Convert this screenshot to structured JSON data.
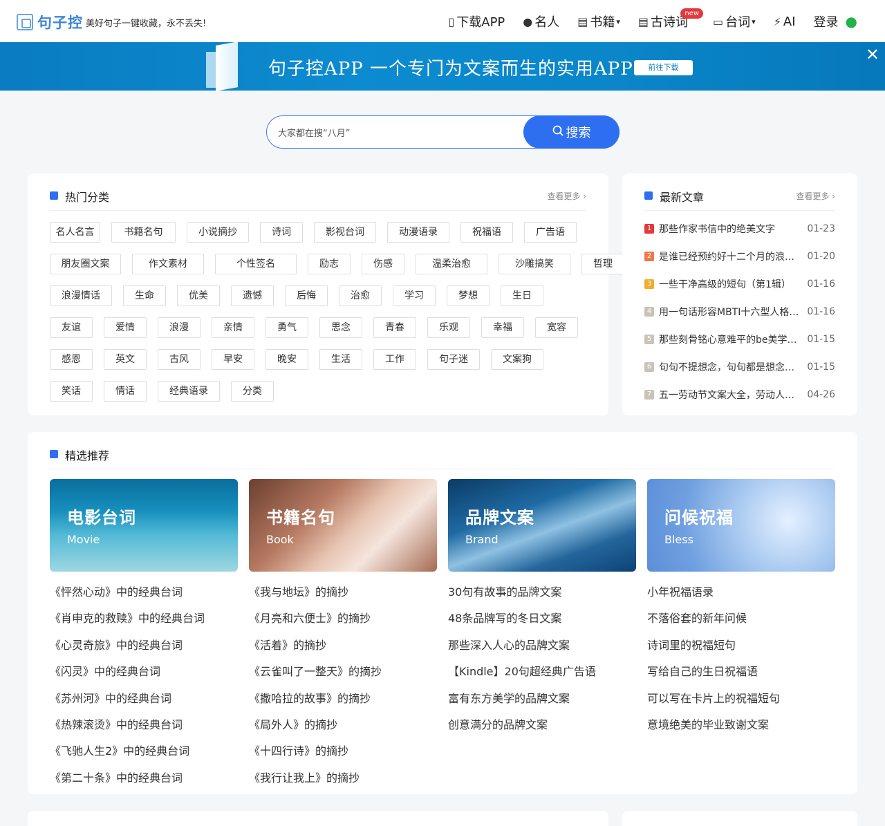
{
  "header": {
    "logo_text": "句子控",
    "slogan": "美好句子一键收藏，永不丢失!",
    "nav": [
      {
        "label": "下载APP",
        "icon": "phone-icon",
        "glyph": "▯"
      },
      {
        "label": "名人",
        "icon": "user-icon",
        "glyph": "👤"
      },
      {
        "label": "书籍",
        "icon": "book-icon",
        "glyph": "▤",
        "caret": "▾"
      },
      {
        "label": "古诗词",
        "icon": "poem-icon",
        "glyph": "▤",
        "badge": "new"
      },
      {
        "label": "台词",
        "icon": "film-icon",
        "glyph": "▭",
        "caret": "▾"
      },
      {
        "label": "AI",
        "icon": "magic-wand-icon",
        "glyph": "⚡"
      }
    ],
    "login": "登录"
  },
  "banner": {
    "title": "句子控APP 一个专门为文案而生的实用APP",
    "button": "前往下载",
    "close": "✕"
  },
  "search": {
    "placeholder": "大家都在搜“八月”",
    "button": "搜索"
  },
  "hot_categories": {
    "title": "热门分类",
    "more": "查看更多 ›",
    "tags": [
      "名人名言",
      "书籍名句",
      "小说摘抄",
      "诗词",
      "影视台词",
      "动漫语录",
      "祝福语",
      "广告语",
      "朋友圈文案",
      "作文素材",
      "个性签名",
      "励志",
      "伤感",
      "温柔治愈",
      "沙雕搞笑",
      "哲理",
      "浪漫情话",
      "生命",
      "优美",
      "遗憾",
      "后悔",
      "治愈",
      "学习",
      "梦想",
      "生日",
      "友谊",
      "爱情",
      "浪漫",
      "亲情",
      "勇气",
      "思念",
      "青春",
      "乐观",
      "幸福",
      "宽容",
      "感恩",
      "英文",
      "古风",
      "早安",
      "晚安",
      "生活",
      "工作",
      "句子迷",
      "文案狗",
      "笑话",
      "情话",
      "经典语录",
      "分类"
    ]
  },
  "latest_articles": {
    "title": "最新文章",
    "more": "查看更多 ›",
    "items": [
      {
        "num": "1",
        "title": "那些作家书信中的绝美文字",
        "date": "01-23",
        "color": "#e4393c"
      },
      {
        "num": "2",
        "title": "是谁已经预约好十二个月的浪漫…",
        "date": "01-20",
        "color": "#f0774a"
      },
      {
        "num": "3",
        "title": "一些干净高级的短句（第1辑）",
        "date": "01-16",
        "color": "#f0ad2e"
      },
      {
        "num": "4",
        "title": "用一句话形容MBTI十六型人格…",
        "date": "01-16",
        "color": "#c8c3b8"
      },
      {
        "num": "5",
        "title": "那些刻骨铭心意难平的be美学…",
        "date": "01-15",
        "color": "#c8c3b8"
      },
      {
        "num": "6",
        "title": "句句不提想念，句句都是想念…",
        "date": "01-15",
        "color": "#c8c3b8"
      },
      {
        "num": "7",
        "title": "五一劳动节文案大全，劳动人民…",
        "date": "04-26",
        "color": "#c8c3b8"
      }
    ]
  },
  "featured": {
    "title": "精选推荐",
    "columns": [
      {
        "name": "电影台词",
        "sub": "Movie",
        "items": [
          "《怦然心动》中的经典台词",
          "《肖申克的救赎》中的经典台词",
          "《心灵奇旅》中的经典台词",
          "《闪灵》中的经典台词",
          "《苏州河》中的经典台词",
          "《热辣滚烫》中的经典台词",
          "《飞驰人生2》中的经典台词",
          "《第二十条》中的经典台词"
        ]
      },
      {
        "name": "书籍名句",
        "sub": "Book",
        "items": [
          "《我与地坛》的摘抄",
          "《月亮和六便士》的摘抄",
          "《活着》的摘抄",
          "《云雀叫了一整天》的摘抄",
          "《撒哈拉的故事》的摘抄",
          "《局外人》的摘抄",
          "《十四行诗》的摘抄",
          "《我行让我上》的摘抄"
        ]
      },
      {
        "name": "品牌文案",
        "sub": "Brand",
        "items": [
          "30句有故事的品牌文案",
          "48条品牌写的冬日文案",
          "那些深入人心的品牌文案",
          "【Kindle】20句超经典广告语",
          "富有东方美学的品牌文案",
          "创意满分的品牌文案"
        ]
      },
      {
        "name": "问候祝福",
        "sub": "Bless",
        "items": [
          "小年祝福语录",
          "不落俗套的新年问候",
          "诗词里的祝福短句",
          "写给自己的生日祝福语",
          "可以写在卡片上的祝福短句",
          "意境绝美的毕业致谢文案"
        ]
      }
    ]
  }
}
